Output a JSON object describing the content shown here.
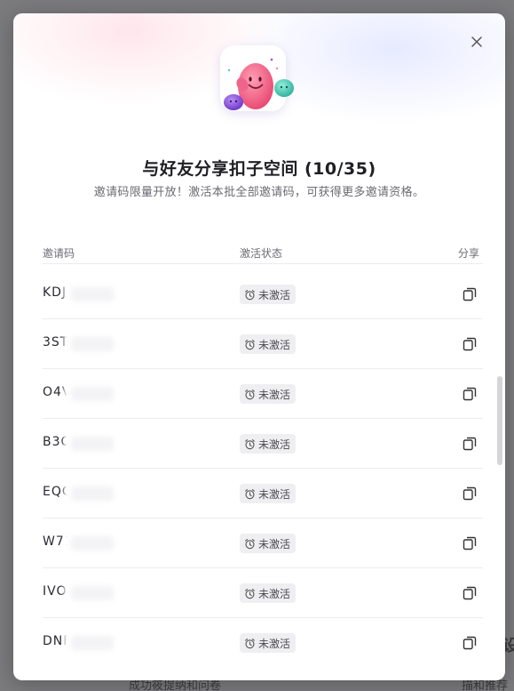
{
  "background": {
    "left_text": "成功筱提纳和问卷",
    "right_text": "描和推荐",
    "edge_text": "设"
  },
  "modal": {
    "title": "与好友分享扣子空间 (10/35)",
    "subtitle": "邀请码限量开放！激活本批全部邀请码，可获得更多邀请资格。",
    "columns": {
      "code": "邀请码",
      "status": "激活状态",
      "share": "分享"
    },
    "rows": [
      {
        "code": "KDJ",
        "status": "未激活"
      },
      {
        "code": "3ST",
        "status": "未激活"
      },
      {
        "code": "O4V",
        "status": "未激活"
      },
      {
        "code": "B3C",
        "status": "未激活"
      },
      {
        "code": "EQC",
        "status": "未激活"
      },
      {
        "code": "W71",
        "status": "未激活"
      },
      {
        "code": "IVO",
        "status": "未激活"
      },
      {
        "code": "DNF",
        "status": "未激活"
      }
    ],
    "icons": {
      "close": "close-icon",
      "status": "alarm-clock-icon",
      "share": "copy-icon",
      "hero": "mascot-illustration"
    },
    "colors": {
      "accent_pink": "#f0648c",
      "accent_teal": "#4cc9b0",
      "accent_purple": "#8a52d9",
      "status_bg": "#efeff2"
    }
  }
}
